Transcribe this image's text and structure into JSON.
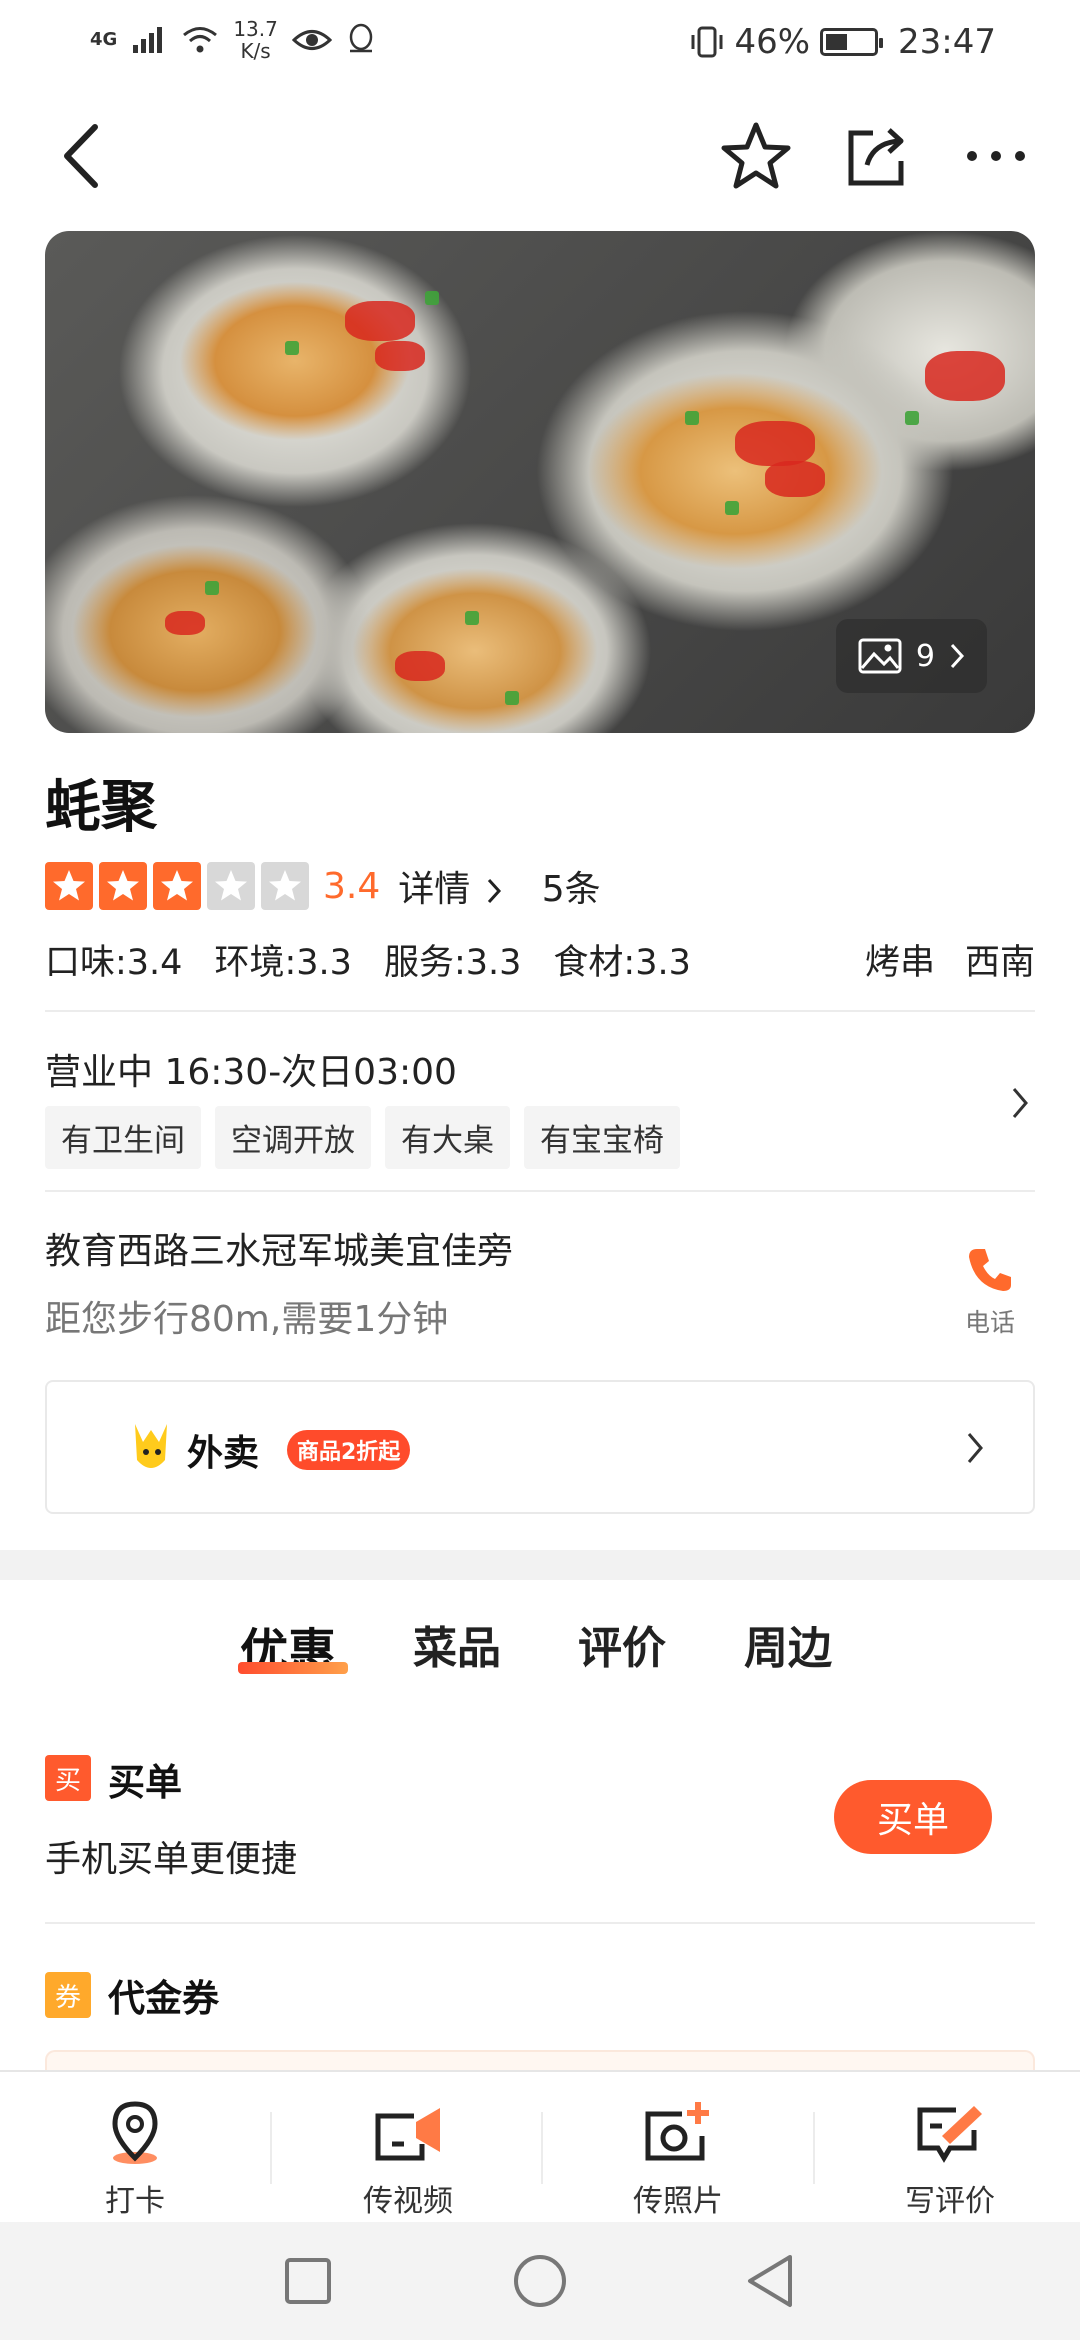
{
  "status_bar": {
    "network": "4G",
    "speed": "13.7\nK/s",
    "battery": "46%",
    "battery_level": 0.46,
    "time": "23:47"
  },
  "shop": {
    "name": "蚝聚",
    "rating": "3.4",
    "stars_filled": 3,
    "stars_total": 5,
    "detail_label": "详情",
    "review_count": "5条",
    "scores": [
      "口味:3.4",
      "环境:3.3",
      "服务:3.3",
      "食材:3.3"
    ],
    "category": "烤串",
    "area": "西南",
    "photo_count": "9"
  },
  "hours": "营业中 16:30-次日03:00",
  "facilities": [
    "有卫生间",
    "空调开放",
    "有大桌",
    "有宝宝椅"
  ],
  "address": {
    "line": "教育西路三水冠军城美宜佳旁",
    "distance": "距您步行80m,需要1分钟",
    "phone_label": "电话"
  },
  "takeout": {
    "title": "外卖",
    "badge": "商品2折起"
  },
  "tabs": [
    "优惠",
    "菜品",
    "评价",
    "周边"
  ],
  "pay": {
    "icon_char": "买",
    "title": "买单",
    "desc": "手机买单更便捷",
    "button": "买单"
  },
  "voucher": {
    "icon_char": "券",
    "title": "代金券"
  },
  "actions": [
    "打卡",
    "传视频",
    "传照片",
    "写评价"
  ],
  "colors": {
    "accent": "#ff6a2c",
    "button": "#ff5a2d",
    "voucher_icon": "#ffa92b",
    "pay_icon": "#ff5a2d"
  },
  "icons": [
    "back-icon",
    "star-icon",
    "share-icon",
    "more-icon",
    "image-icon",
    "phone-icon",
    "location-pin-icon",
    "video-icon",
    "camera-plus-icon",
    "edit-review-icon"
  ]
}
